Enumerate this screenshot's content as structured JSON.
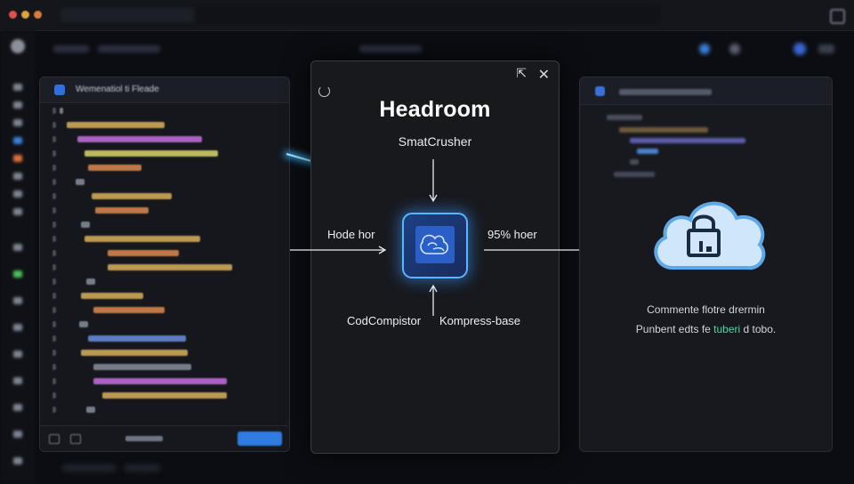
{
  "modal": {
    "title": "Headroom",
    "top_label": "SmatCrusher",
    "left_label": "Hode hor",
    "right_label": "95% hoer",
    "bottom_left_label": "CodCompistor",
    "bottom_right_label": "Kompress-base"
  },
  "right_panel": {
    "line1": "Commente flotre drermin",
    "line2_prefix": "Punbent edts fe ",
    "line2_highlight": "tuberi",
    "line2_suffix": " d tobo."
  },
  "code_panel": {
    "title": "Wemenatiol ti Fleade"
  },
  "colors": {
    "accent": "#2f7de0",
    "core_border": "#58b6ff",
    "cloud_fill": "#cfe6fb",
    "highlight_text": "#54d6a8"
  },
  "icons": [
    "close-icon",
    "expand-icon",
    "reload-icon",
    "compressor-icon",
    "cloud-lock-icon"
  ]
}
